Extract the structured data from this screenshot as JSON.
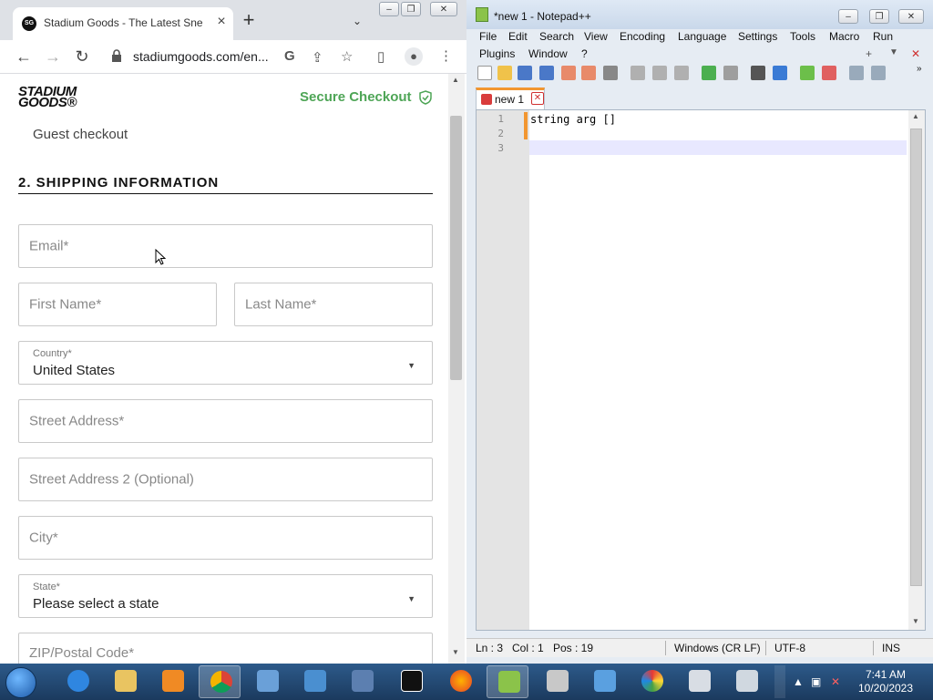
{
  "chrome": {
    "tab_title": "Stadium Goods - The Latest Snea",
    "url": "stadiumgoods.com/en...",
    "favicon_text": "SG"
  },
  "page": {
    "logo_line1": "STADIUM",
    "logo_line2": "GOODS®",
    "secure_checkout": "Secure Checkout",
    "guest_checkout": "Guest checkout",
    "section_title": "2. SHIPPING INFORMATION",
    "email_placeholder": "Email*",
    "first_name_placeholder": "First Name*",
    "last_name_placeholder": "Last Name*",
    "country_label": "Country*",
    "country_value": "United States",
    "street_placeholder": "Street Address*",
    "street2_placeholder": "Street Address 2 (Optional)",
    "city_placeholder": "City*",
    "state_label": "State*",
    "state_value": "Please select a state",
    "zip_placeholder": "ZIP/Postal Code*"
  },
  "npp": {
    "title": "*new 1 - Notepad++",
    "menu": [
      "File",
      "Edit",
      "Search",
      "View",
      "Encoding",
      "Language",
      "Settings",
      "Tools",
      "Macro",
      "Run",
      "Plugins",
      "Window",
      "?"
    ],
    "doc_tab": "new 1",
    "lines": [
      "string arg []",
      "",
      ""
    ],
    "line_numbers": [
      "1",
      "2",
      "3"
    ],
    "status": {
      "ln": "Ln : 3",
      "col": "Col : 1",
      "pos": "Pos : 19",
      "eol": "Windows (CR LF)",
      "encoding": "UTF-8",
      "mode": "INS"
    }
  },
  "taskbar": {
    "time": "7:41 AM",
    "date": "10/20/2023",
    "apps": [
      "internet-explorer",
      "file-explorer",
      "media-player",
      "chrome",
      "control-panel",
      "network",
      "search",
      "7zip",
      "firefox",
      "notepad-plus-plus",
      "printer",
      "paper-plane",
      "paint",
      "calculator",
      "snipping-tool"
    ]
  }
}
